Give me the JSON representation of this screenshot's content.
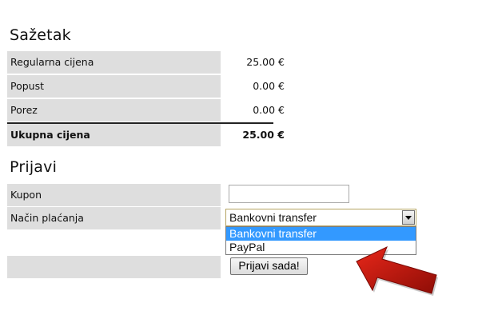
{
  "summary": {
    "title": "Sažetak",
    "rows": [
      {
        "label": "Regularna cijena",
        "value": "25.00 €"
      },
      {
        "label": "Popust",
        "value": "0.00 €"
      },
      {
        "label": "Porez",
        "value": "0.00 €"
      }
    ],
    "total": {
      "label": "Ukupna cijena",
      "value": "25.00 €"
    }
  },
  "checkout": {
    "title": "Prijavi",
    "coupon_label": "Kupon",
    "coupon_value": "",
    "payment_label": "Način plaćanja",
    "payment_selected": "Bankovni transfer",
    "payment_options": [
      "Bankovni transfer",
      "PayPal"
    ],
    "submit_label": "Prijavi sada!"
  },
  "colors": {
    "row_background": "#dedede",
    "option_highlight": "#3399ff",
    "arrow": "#c41a10"
  },
  "icons": {
    "select_toggle": "chevron-down-icon",
    "annotation": "red-arrow-icon"
  }
}
